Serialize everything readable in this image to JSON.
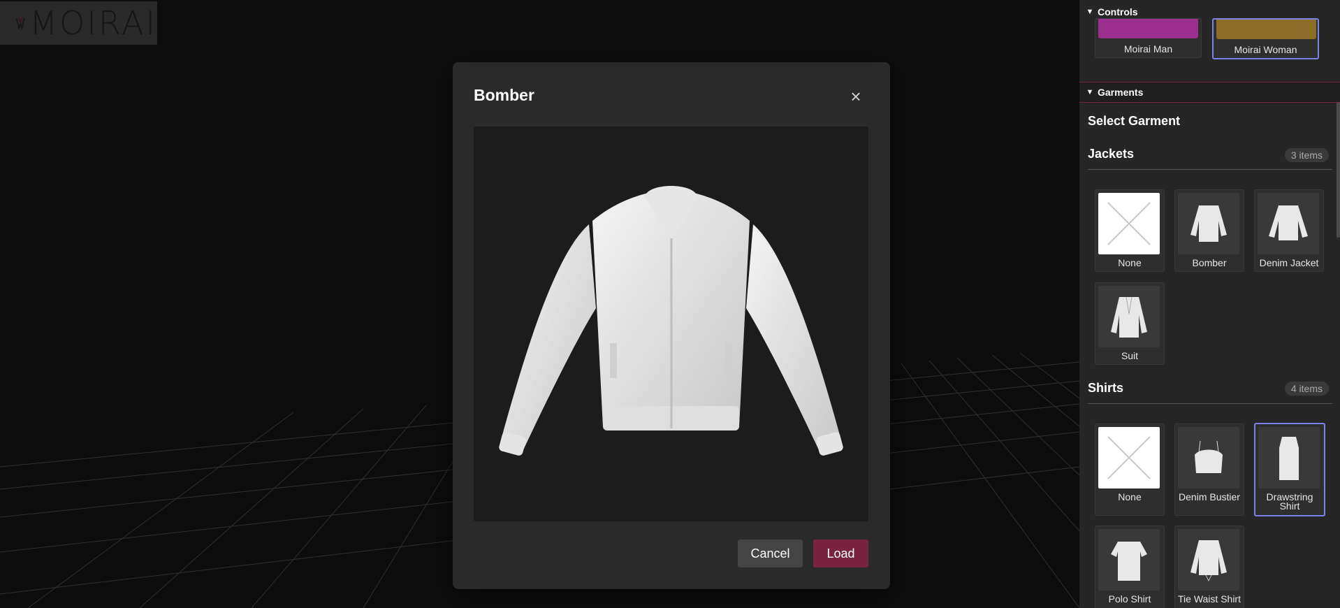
{
  "app": {
    "logo_text": "MOIRAI"
  },
  "modal": {
    "title": "Bomber",
    "close_symbol": "×",
    "cancel_label": "Cancel",
    "load_label": "Load"
  },
  "sidebar": {
    "controls": {
      "title": "Controls",
      "avatars": [
        {
          "label": "Moirai Man",
          "color": "#9b2f8f",
          "selected": false
        },
        {
          "label": "Moirai Woman",
          "color": "#8a6d27",
          "selected": true
        }
      ]
    },
    "garments": {
      "title": "Garments",
      "heading": "Select Garment",
      "categories": [
        {
          "name": "Jackets",
          "count": "3 items",
          "items": [
            {
              "label": "None",
              "icon": "none-x-icon",
              "selected": false
            },
            {
              "label": "Bomber",
              "icon": "bomber-jacket-icon",
              "selected": false
            },
            {
              "label": "Denim Jacket",
              "icon": "denim-jacket-icon",
              "selected": false
            },
            {
              "label": "Suit",
              "icon": "suit-jacket-icon",
              "selected": false
            }
          ]
        },
        {
          "name": "Shirts",
          "count": "4 items",
          "items": [
            {
              "label": "None",
              "icon": "none-x-icon",
              "selected": false
            },
            {
              "label": "Denim Bustier",
              "icon": "bustier-icon",
              "selected": false
            },
            {
              "label": "Drawstring Shirt",
              "icon": "drawstring-shirt-icon",
              "selected": true
            },
            {
              "label": "Polo Shirt",
              "icon": "polo-shirt-icon",
              "selected": false
            },
            {
              "label": "Tie Waist Shirt",
              "icon": "tie-waist-shirt-icon",
              "selected": false
            }
          ]
        }
      ]
    }
  },
  "colors": {
    "accent": "#7a2340",
    "selection": "#7b83e8",
    "panel": "#262626",
    "modal": "#2a2a2a"
  }
}
